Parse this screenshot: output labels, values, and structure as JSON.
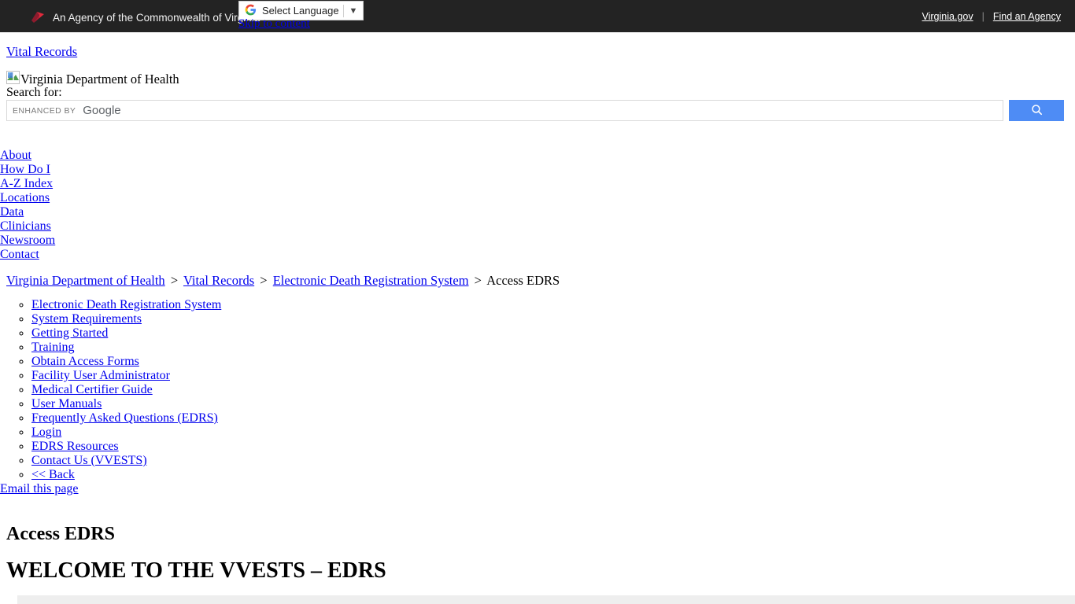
{
  "topbar": {
    "agency_text": "An Agency of the Commonwealth of Virginia",
    "logo_icon": "virginia-logo-icon",
    "virginia_gov": "Virginia.gov",
    "separator": "|",
    "find_an_agency": "Find an Agency"
  },
  "translate": {
    "icon": "google-g-icon",
    "label": "Select Language",
    "caret": "▼"
  },
  "skip": {
    "label": "Skip to content"
  },
  "branding": {
    "vital_records": "Vital Records",
    "broken_image_icon": "broken-image-icon",
    "site_title": "Virginia Department of Health"
  },
  "search": {
    "label": "Search for:",
    "value": "",
    "placeholder": "",
    "watermark_enhanced": "ENHANCED BY",
    "watermark_google": "Google",
    "button_icon": "search-icon",
    "button_color": "#4e8cf5"
  },
  "utility_nav": {
    "items": [
      {
        "label": ""
      },
      {
        "label": "About"
      },
      {
        "label": "How Do I"
      },
      {
        "label": "A-Z Index"
      },
      {
        "label": "Locations"
      },
      {
        "label": "Data"
      },
      {
        "label": "Clinicians"
      },
      {
        "label": "Newsroom"
      },
      {
        "label": "Contact"
      }
    ]
  },
  "breadcrumb": {
    "items": [
      {
        "label": "Virginia Department of Health",
        "link": true
      },
      {
        "label": "Vital Records",
        "link": true
      },
      {
        "label": "Electronic Death Registration System",
        "link": true
      },
      {
        "label": "Access EDRS",
        "link": false
      }
    ],
    "separator": ">"
  },
  "section_menu": {
    "items": [
      {
        "label": "Electronic Death Registration System"
      },
      {
        "label": "System Requirements"
      },
      {
        "label": "Getting Started"
      },
      {
        "label": "Training"
      },
      {
        "label": "Obtain Access Forms"
      },
      {
        "label": "Facility User Administrator"
      },
      {
        "label": "Medical Certifier Guide"
      },
      {
        "label": "User Manuals"
      },
      {
        "label": "Frequently Asked Questions (EDRS)"
      },
      {
        "label": "Login"
      },
      {
        "label": "EDRS Resources"
      },
      {
        "label": "Contact Us (VVESTS)"
      },
      {
        "label": "<< Back"
      }
    ],
    "email_this_page": "Email this page"
  },
  "main": {
    "page_title": "Access EDRS",
    "welcome_heading": "WELCOME TO THE VVESTS – EDRS"
  },
  "colors": {
    "topbar_bg": "#232323",
    "link": "#0000EE",
    "search_button": "#4e8cf5",
    "band": "#eeeeee"
  }
}
